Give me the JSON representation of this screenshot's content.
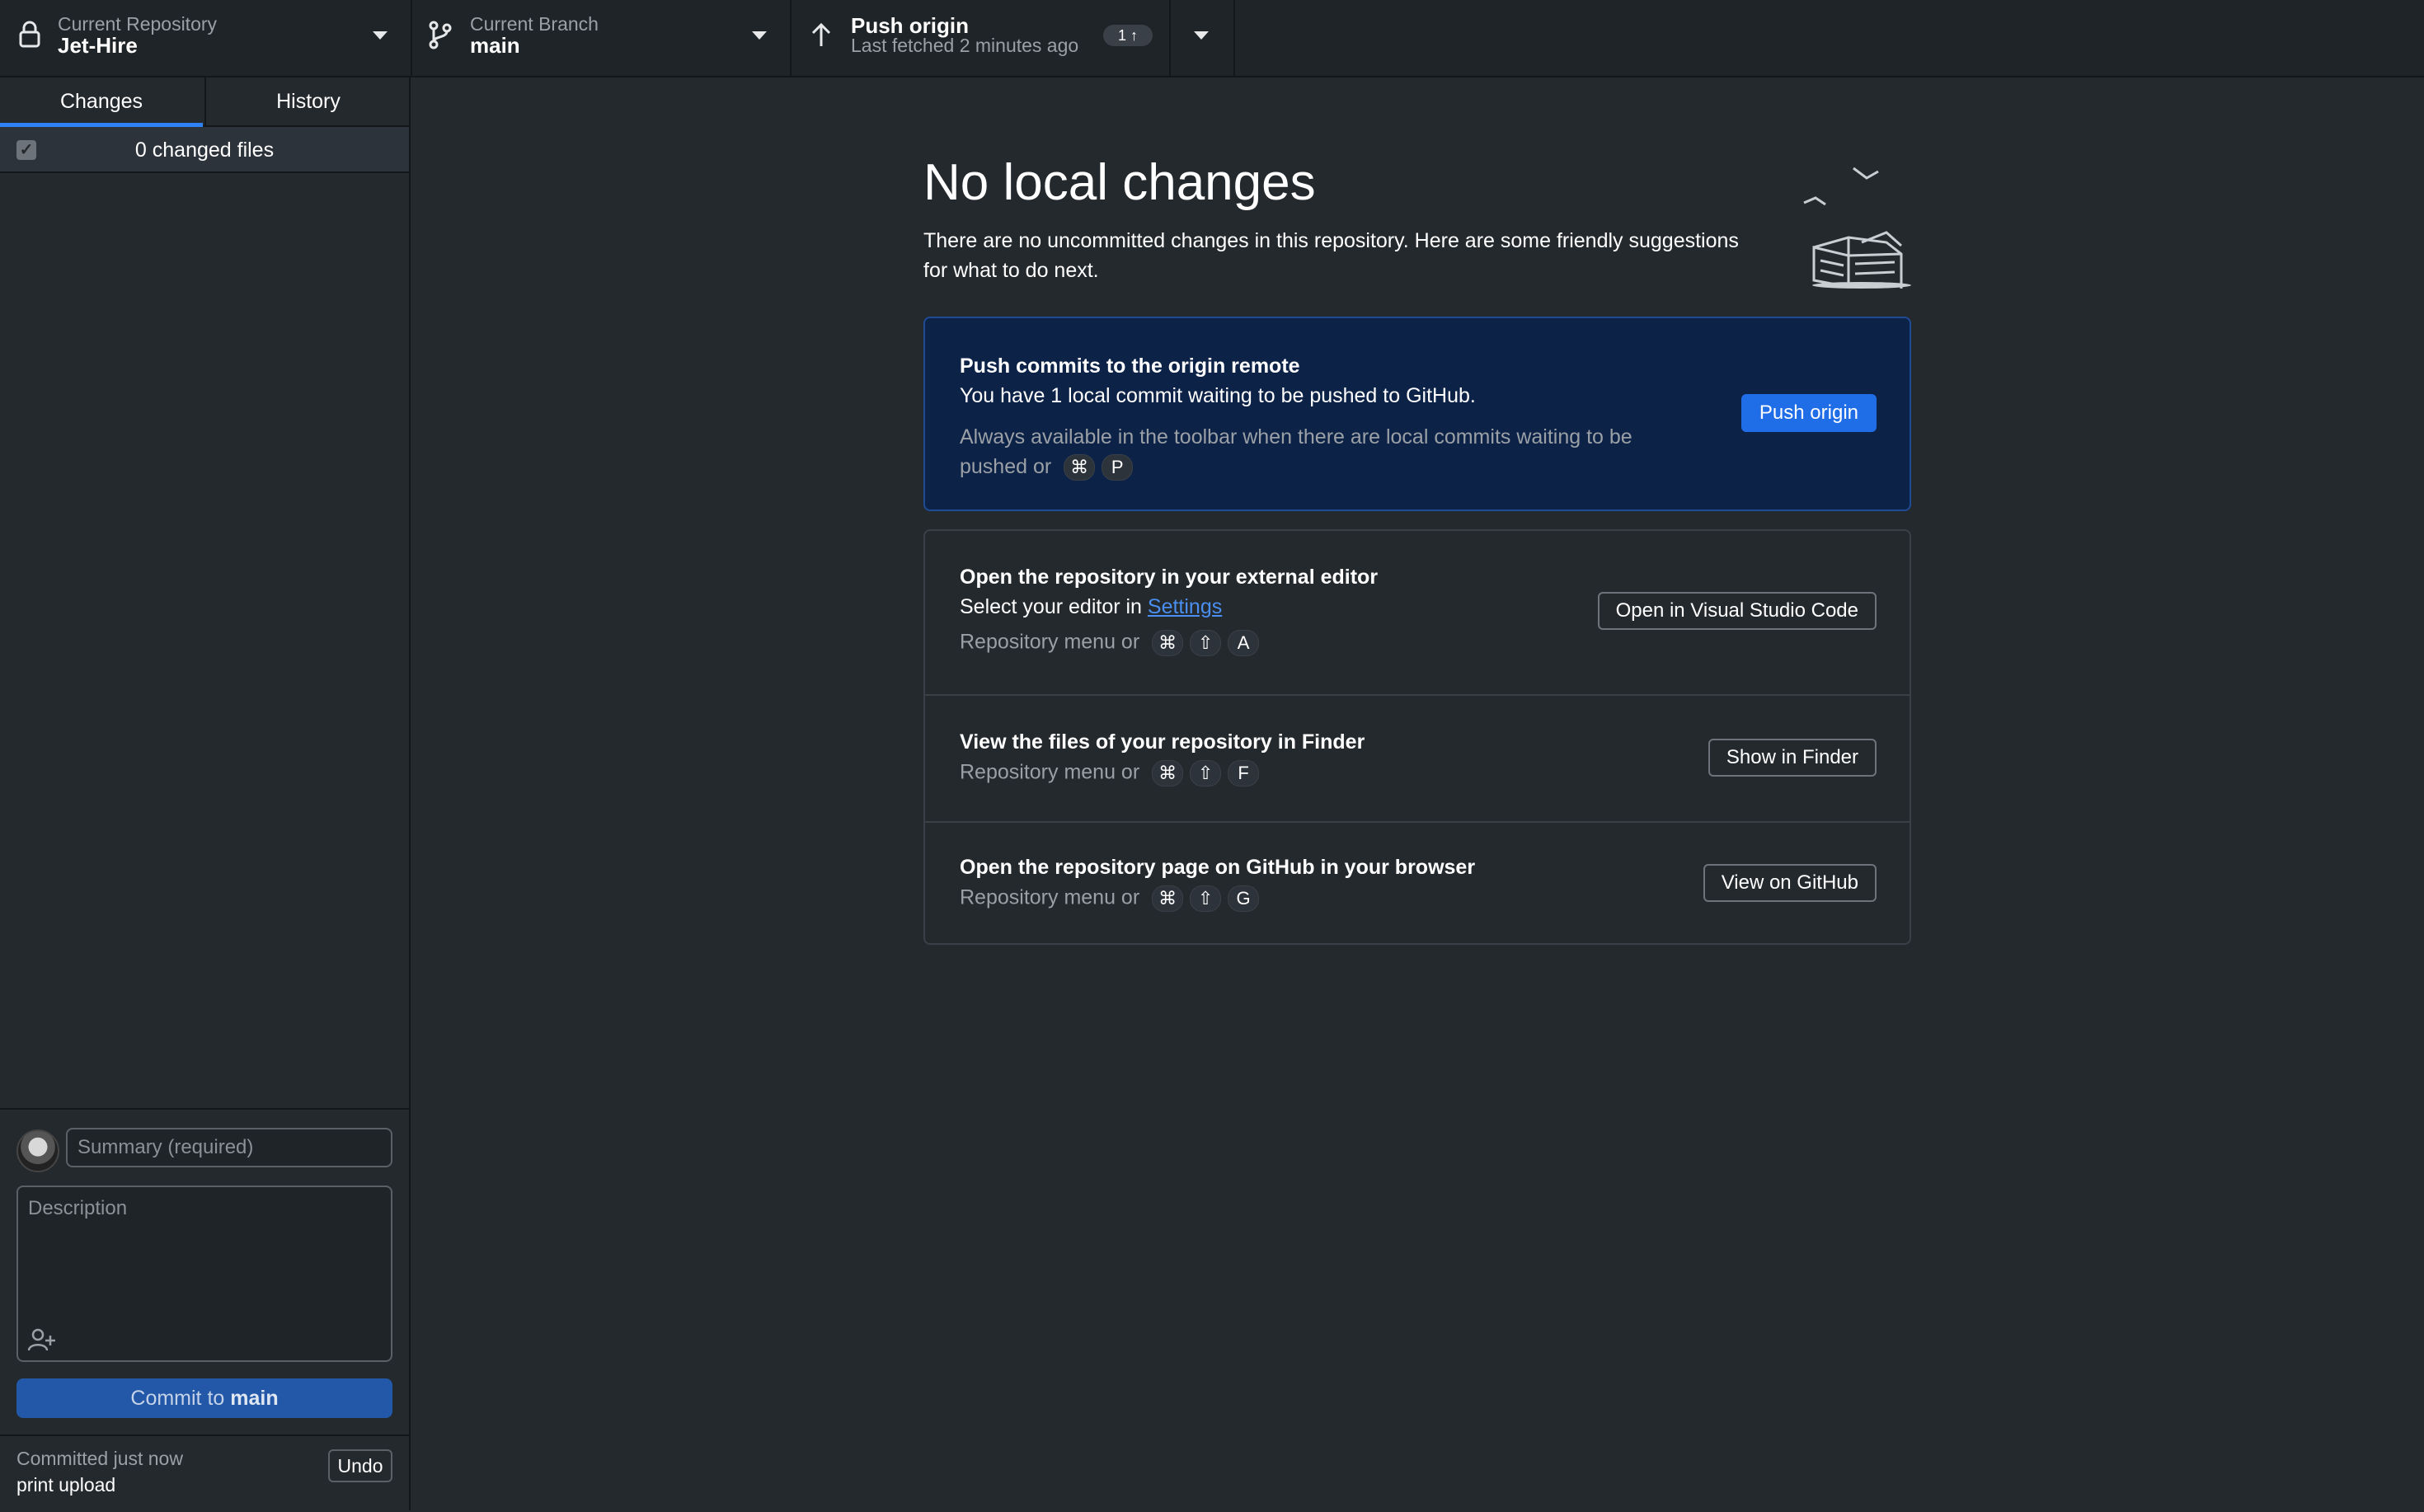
{
  "toolbar": {
    "repository": {
      "label": "Current Repository",
      "value": "Jet-Hire"
    },
    "branch": {
      "label": "Current Branch",
      "value": "main"
    },
    "push": {
      "label": "Push origin",
      "subtitle": "Last fetched 2 minutes ago",
      "badge": "1 ↑"
    }
  },
  "sidebar": {
    "tabs": [
      {
        "label": "Changes",
        "active": true
      },
      {
        "label": "History",
        "active": false
      }
    ],
    "changed_files": "0 changed files",
    "commit": {
      "summary_placeholder": "Summary (required)",
      "description_placeholder": "Description",
      "button_prefix": "Commit to ",
      "button_branch": "main"
    },
    "last_commit": {
      "when": "Committed just now",
      "message": "print upload",
      "undo": "Undo"
    }
  },
  "main": {
    "title": "No local changes",
    "subtitle": "There are no uncommitted changes in this repository. Here are some friendly suggestions for what to do next.",
    "push_card": {
      "title": "Push commits to the origin remote",
      "description": "You have 1 local commit waiting to be pushed to GitHub.",
      "hint_prefix": "Always available in the toolbar when there are local commits waiting to be pushed or",
      "keys": [
        "⌘",
        "P"
      ],
      "button": "Push origin"
    },
    "suggestions": [
      {
        "title": "Open the repository in your external editor",
        "description_prefix": "Select your editor in ",
        "description_link": "Settings",
        "hint": "Repository menu or",
        "keys": [
          "⌘",
          "⇧",
          "A"
        ],
        "button": "Open in Visual Studio Code"
      },
      {
        "title": "View the files of your repository in Finder",
        "hint": "Repository menu or",
        "keys": [
          "⌘",
          "⇧",
          "F"
        ],
        "button": "Show in Finder"
      },
      {
        "title": "Open the repository page on GitHub in your browser",
        "hint": "Repository menu or",
        "keys": [
          "⌘",
          "⇧",
          "G"
        ],
        "button": "View on GitHub"
      }
    ]
  },
  "colors": {
    "accent": "#1f6ee8",
    "push_card_bg": "#0d2247",
    "background": "#24292e"
  }
}
